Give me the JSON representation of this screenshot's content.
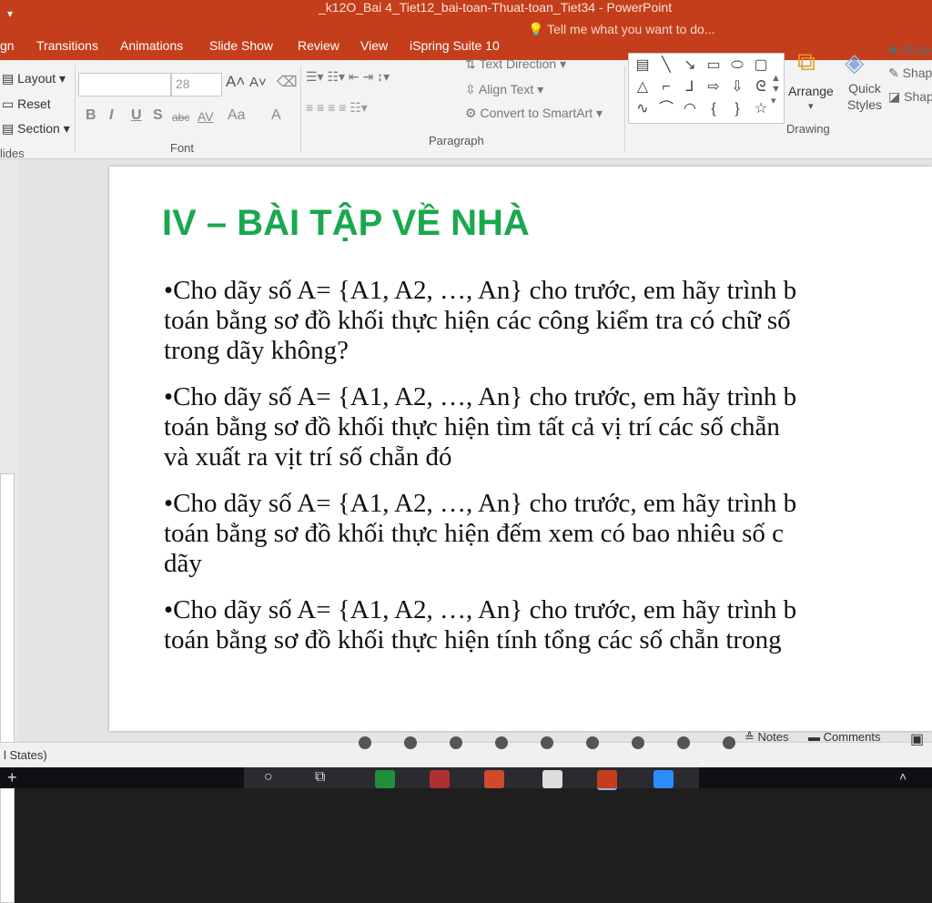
{
  "window": {
    "quick_access": "▾",
    "doc_title": "_k12O_Bai 4_Tiet12_bai-toan-Thuat-toan_Tiet34 - PowerPoint"
  },
  "ribbon_tabs": [
    "gn",
    "Transitions",
    "Animations",
    "Slide Show",
    "Review",
    "View",
    "iSpring Suite 10"
  ],
  "tell_me": "Tell me what you want to do...",
  "slides_group": {
    "layout": "Layout",
    "reset": "Reset",
    "section": "Section",
    "label": "lides"
  },
  "font_group": {
    "size": "28",
    "label": "Font",
    "bold": "B",
    "italic": "I",
    "underline": "U",
    "shadow": "S",
    "strike": "abc",
    "spacing": "AV",
    "case": "Aa",
    "color": "A",
    "grow": "A",
    "shrink": "A"
  },
  "paragraph_group": {
    "text_direction": "Text Direction",
    "align_text": "Align Text",
    "convert_smartart": "Convert to SmartArt",
    "label": "Paragraph"
  },
  "drawing_group": {
    "arrange": "Arrange",
    "quick_styles": "Quick Styles",
    "shape_fill": "Shap",
    "shape_outline": "Shap",
    "shape_effects": "Shap",
    "label": "Drawing"
  },
  "slide": {
    "title": "IV – BÀI TẬP VỀ NHÀ",
    "paragraphs": [
      [
        "•Cho dãy số A= {A1, A2, …, An} cho trước, em hãy trình b",
        "toán bằng sơ đồ khối  thực hiện các công kiểm tra có chữ số",
        "trong dãy không?"
      ],
      [
        "•Cho dãy số A= {A1, A2, …, An} cho trước, em hãy trình b",
        "toán bằng sơ đồ khối  thực hiện tìm tất cả vị trí các số chẵn",
        "và xuất ra vịt trí số chẵn đó"
      ],
      [
        "•Cho dãy số A= {A1, A2, …, An} cho trước, em hãy trình b",
        "toán bằng sơ đồ khối  thực hiện  đếm xem có bao nhiêu số c",
        "dãy"
      ],
      [
        "•Cho dãy số A= {A1, A2, …, An} cho trước, em hãy trình b",
        "toán bằng sơ đồ khối  thực hiện tính tổng các số chẵn trong"
      ]
    ]
  },
  "statusbar": {
    "left": "l States)",
    "notes": "Notes",
    "comments": "Comments"
  },
  "colors": {
    "accent": "#c43e1c",
    "title_green": "#1aa84f"
  }
}
